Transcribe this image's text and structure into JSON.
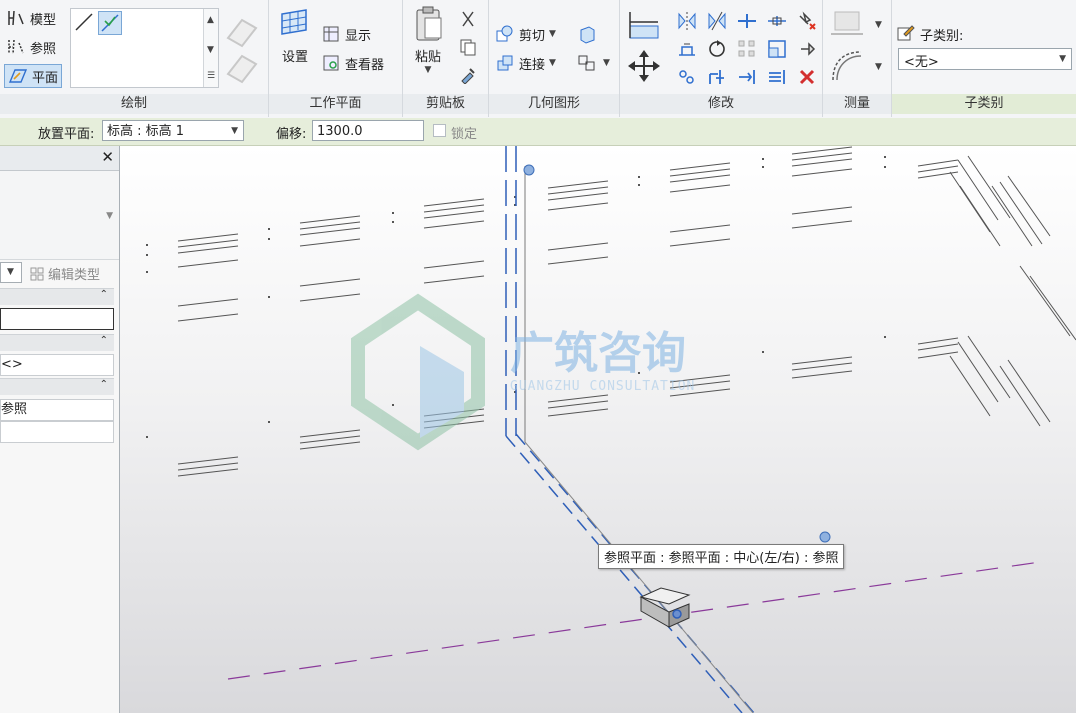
{
  "ribbon": {
    "draw": {
      "title": "绘制",
      "model_label": "模型",
      "reference_label": "参照",
      "plane_label": "平面"
    },
    "workplane": {
      "title": "工作平面",
      "set_label": "设置",
      "show_label": "显示",
      "viewer_label": "查看器"
    },
    "clipboard": {
      "title": "剪贴板",
      "paste_label": "粘贴"
    },
    "geometry": {
      "title": "几何图形",
      "cut_label": "剪切",
      "join_label": "连接"
    },
    "modify": {
      "title": "修改"
    },
    "measure": {
      "title": "测量"
    },
    "subcategory": {
      "title": "子类别",
      "label": "子类别:",
      "value": "<无>"
    }
  },
  "options_bar": {
    "placement_label": "放置平面:",
    "placement_value": "标高 : 标高 1",
    "offset_label": "偏移:",
    "offset_value": "1300.0",
    "lock_label": "锁定"
  },
  "properties": {
    "close_glyph": "✕",
    "edit_type_label": "编辑类型",
    "row_value_1": "<>",
    "row_value_2": "参照"
  },
  "viewport": {
    "tooltip": "参照平面 : 参照平面 : 中心(左/右) : 参照",
    "watermark_cn": "广筑咨询",
    "watermark_en": "GUANGZHU CONSULTATION"
  },
  "colors": {
    "ribbon_bg": "#f4f5f7",
    "options_bar_bg": "#e6eedb",
    "accent_blue": "#2f6fcf",
    "ref_plane_purple": "#8a3a9a",
    "selected_bg": "#cfe3f6"
  }
}
